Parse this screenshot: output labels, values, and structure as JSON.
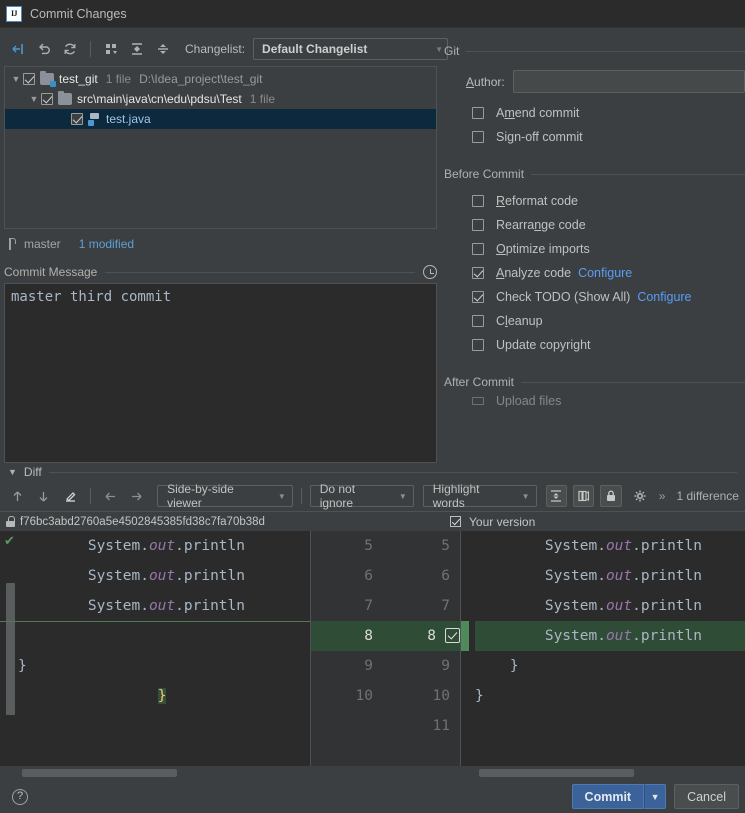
{
  "window": {
    "title": "Commit Changes",
    "logo_text": "IJ"
  },
  "toolbar": {
    "icons": [
      "collapse-to-left-icon",
      "undo-icon",
      "refresh-icon",
      "group-by-icon",
      "expand-all-icon",
      "collapse-all-icon"
    ],
    "changelist_label": "Changelist:",
    "changelist_value": "Default Changelist"
  },
  "tree": {
    "rows": [
      {
        "name": "test_git",
        "meta": "1 file",
        "path": "D:\\Idea_project\\test_git",
        "indent": 0,
        "checked": true,
        "expanded": true,
        "type": "vcs-root",
        "selected": false
      },
      {
        "name": "src\\main\\java\\cn\\edu\\pdsu\\Test",
        "meta": "1 file",
        "path": "",
        "indent": 1,
        "checked": true,
        "expanded": true,
        "type": "folder",
        "selected": false
      },
      {
        "name": "test.java",
        "meta": "",
        "path": "",
        "indent": 2,
        "checked": true,
        "expanded": null,
        "type": "java-file",
        "selected": true
      }
    ]
  },
  "branch_bar": {
    "branch": "master",
    "modified": "1 modified"
  },
  "commit_message": {
    "label": "Commit Message",
    "label_mnemonic": "C",
    "value": "master third commit",
    "history_icon": "clock-icon"
  },
  "git_group": {
    "title": "Git",
    "author_label": "Author:",
    "author_value": "",
    "checkboxes": [
      {
        "label": "Amend commit",
        "checked": false
      },
      {
        "label": "Sign-off commit",
        "checked": false
      }
    ]
  },
  "before_commit_group": {
    "title": "Before Commit",
    "checkboxes": [
      {
        "label": "Reformat code",
        "checked": false,
        "link": ""
      },
      {
        "label": "Rearrange code",
        "checked": false,
        "link": ""
      },
      {
        "label": "Optimize imports",
        "checked": false,
        "link": ""
      },
      {
        "label": "Analyze code",
        "checked": true,
        "link": "Configure"
      },
      {
        "label": "Check TODO (Show All)",
        "checked": true,
        "link": "Configure"
      },
      {
        "label": "Cleanup",
        "checked": false,
        "link": ""
      },
      {
        "label": "Update copyright",
        "checked": false,
        "link": ""
      }
    ]
  },
  "after_commit_group": {
    "title": "After Commit",
    "clipped_item": "Upload files"
  },
  "diff": {
    "title": "Diff",
    "nav_icons": [
      "arrow-up-icon",
      "arrow-down-icon",
      "edit-pencil-icon",
      "arrow-left-icon",
      "arrow-right-icon"
    ],
    "viewer_mode": "Side-by-side viewer",
    "whitespace_mode": "Do not ignore",
    "highlight_mode": "Highlight words",
    "toggle_icons": [
      "collapse-unchanged-icon",
      "show-whitespace-icon",
      "lock-icon",
      "settings-gear-icon"
    ],
    "overflow_icon": "chevron-double-right-icon",
    "difference_count": "1 difference",
    "left_header": {
      "icon": "lock-icon",
      "revision": "f76bc3abd2760a5e4502845385fd38c7fa70b38d"
    },
    "right_header": {
      "checked": true,
      "label": "Your version"
    },
    "left_lines": [
      {
        "text": "        System.out.println",
        "type": "normal"
      },
      {
        "text": "        System.out.println",
        "type": "normal"
      },
      {
        "text": "        System.out.println",
        "type": "normal"
      },
      {
        "text": "    }",
        "type": "brace-highlight"
      },
      {
        "text": "}",
        "type": "normal"
      },
      {
        "text": "",
        "type": "empty"
      },
      {
        "text": "",
        "type": "empty"
      }
    ],
    "right_lines": [
      {
        "text": "        System.out.println",
        "type": "normal"
      },
      {
        "text": "        System.out.println",
        "type": "normal"
      },
      {
        "text": "        System.out.println",
        "type": "normal"
      },
      {
        "text": "        System.out.println",
        "type": "added"
      },
      {
        "text": "    }",
        "type": "normal"
      },
      {
        "text": "}",
        "type": "normal"
      },
      {
        "text": "",
        "type": "empty"
      }
    ],
    "gutter_lines": [
      {
        "left": "5",
        "right": "5",
        "highlight": false,
        "accept": false
      },
      {
        "left": "6",
        "right": "6",
        "highlight": false,
        "accept": false
      },
      {
        "left": "7",
        "right": "7",
        "highlight": false,
        "accept": false
      },
      {
        "left": "8",
        "right": "8",
        "highlight": true,
        "accept": true
      },
      {
        "left": "9",
        "right": "9",
        "highlight": false,
        "accept": false
      },
      {
        "left": "10",
        "right": "10",
        "highlight": false,
        "accept": false
      },
      {
        "left": "",
        "right": "11",
        "highlight": false,
        "accept": false
      }
    ]
  },
  "footer": {
    "help_label": "?",
    "commit_label": "Commit",
    "commit_dropdown_icon": "chevron-down-icon",
    "cancel_label": "Cancel"
  },
  "colors": {
    "background": "#3c3f41",
    "editor_background": "#2b2b2b",
    "selection": "#0d293e",
    "link": "#589df6",
    "added_line": "#2f4c36",
    "accent_blue": "#3592c4",
    "commit_button": "#3c6399"
  }
}
